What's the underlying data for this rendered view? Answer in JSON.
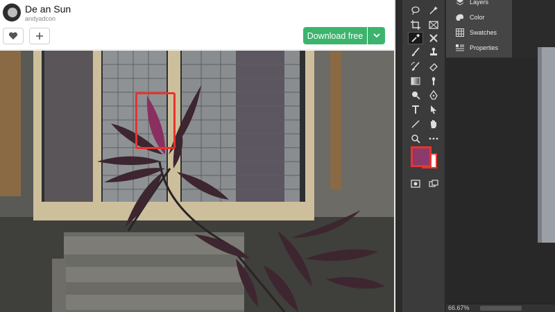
{
  "author": {
    "name": "De an Sun",
    "handle": "andyadcon"
  },
  "actions": {
    "like_icon": "heart-icon",
    "add_icon": "plus-icon",
    "download_label": "Download free",
    "download_caret_icon": "chevron-down-icon"
  },
  "colors": {
    "download_button": "#3cb46e",
    "highlight": "#e8332f",
    "foreground_color": "#8b3a6c",
    "background_color": "#ffffff"
  },
  "tools": [
    "lasso-icon",
    "magic-wand-icon",
    "crop-icon",
    "frame-icon",
    "eyedropper-icon",
    "healing-icon",
    "brush-icon",
    "stamp-icon",
    "history-brush-icon",
    "eraser-icon",
    "gradient-icon",
    "smudge-icon",
    "dodge-icon",
    "pen-icon",
    "type-icon",
    "path-select-icon",
    "line-icon",
    "hand-icon",
    "zoom-icon",
    "more-icon",
    "quick-mask-icon",
    "screen-mode-icon"
  ],
  "panels": [
    {
      "label": "Layers",
      "icon": "layers-icon"
    },
    {
      "label": "Color",
      "icon": "color-icon"
    },
    {
      "label": "Swatches",
      "icon": "swatches-icon"
    },
    {
      "label": "Properties",
      "icon": "properties-icon"
    }
  ],
  "status": {
    "zoom": "66.67%"
  }
}
